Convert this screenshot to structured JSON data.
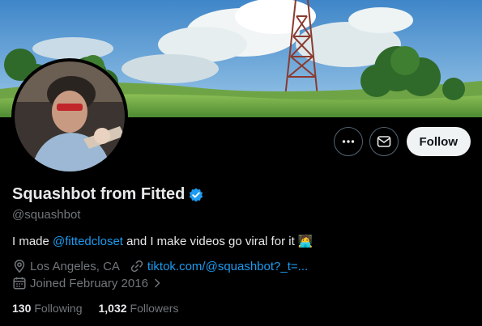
{
  "profile": {
    "display_name": "Squashbot from Fitted",
    "handle": "@squashbot",
    "verified": true,
    "bio_prefix": "I made ",
    "bio_mention": "@fittedcloset",
    "bio_suffix": " and I make videos go viral for it",
    "bio_emoji": "🧑‍💻",
    "location": "Los Angeles, CA",
    "website": "tiktok.com/@squashbot?_t=...",
    "joined": "Joined February 2016",
    "following_count": "130",
    "following_label": "Following",
    "followers_count": "1,032",
    "followers_label": "Followers"
  },
  "actions": {
    "follow_label": "Follow"
  },
  "icons": {
    "more": "more-horizontal-icon",
    "message": "envelope-icon",
    "verified": "verified-badge-icon",
    "location": "location-pin-icon",
    "link": "link-icon",
    "calendar": "calendar-icon",
    "chevron": "chevron-right-icon"
  },
  "colors": {
    "accent": "#1d9bf0",
    "muted": "#71767b",
    "text": "#e7e9ea",
    "background": "#000000"
  }
}
